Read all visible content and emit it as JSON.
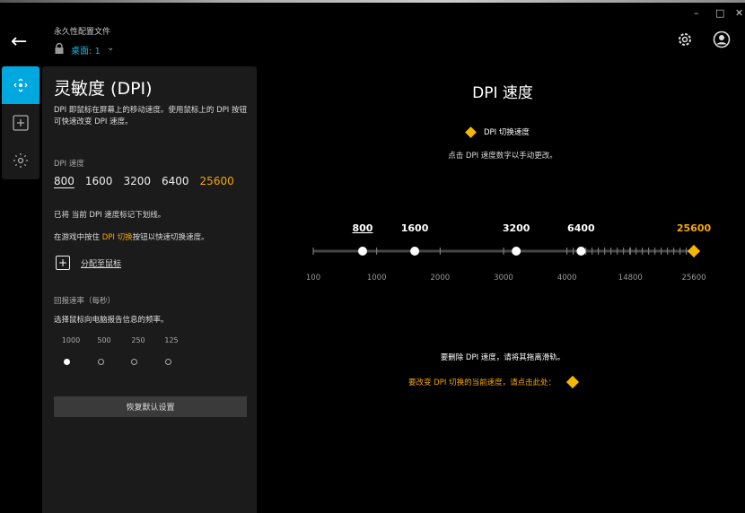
{
  "window": {
    "minimize": "–",
    "maximize": "□",
    "close": "✕"
  },
  "header": {
    "profile_title": "永久性配置文件",
    "profile_selected": "桌面: 1"
  },
  "sidebar": {
    "items": [
      {
        "icon": "move-icon",
        "active": true
      },
      {
        "icon": "plus-box-icon"
      },
      {
        "icon": "lighting-icon"
      }
    ]
  },
  "panel": {
    "title": "灵敏度 (DPI)",
    "description": "DPI 即鼠标在屏幕上的移动速度。使用鼠标上的 DPI 按钮可快速改变 DPI 速度。",
    "dpi_label": "DPI 速度",
    "dpi_values": [
      "800",
      "1600",
      "3200",
      "6400",
      "25600"
    ],
    "note1": "已将 当前 DPI 速度标记下划线。",
    "note2_pre": "在游戏中按住 ",
    "note2_highlight": "DPI 切换",
    "note2_post": "按钮以快速切换速度。",
    "assign_label": "分配至鼠标",
    "report_label": "回报速率（每秒）",
    "report_desc": "选择鼠标向电脑报告信息的频率。",
    "report_rates": [
      "1000",
      "500",
      "250",
      "125"
    ],
    "report_selected": "1000",
    "reset_label": "恢复默认设置"
  },
  "main": {
    "title": "DPI 速度",
    "legend_label": "DPI 切换速度",
    "hint": "点击 DPI 速度数字以手动更改。",
    "remove_hint": "要删除 DPI 速度，请将其拖离滑轨。",
    "shift_hint": "要改变 DPI 切换的当前速度，请点击此处："
  },
  "slider": {
    "axis_labels": [
      "100",
      "1000",
      "2000",
      "3000",
      "4000",
      "14800",
      "25600"
    ],
    "handles": [
      {
        "value": 800,
        "label": "800",
        "current": true
      },
      {
        "value": 1600,
        "label": "1600"
      },
      {
        "value": 3200,
        "label": "3200"
      },
      {
        "value": 6400,
        "label": "6400"
      },
      {
        "value": 25600,
        "label": "25600",
        "shift": true
      }
    ]
  },
  "colors": {
    "accent": "#00a8e0",
    "gold": "#f5a800"
  }
}
